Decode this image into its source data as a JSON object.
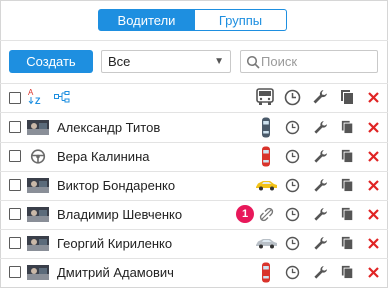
{
  "tabs": [
    {
      "label": "Водители",
      "active": true
    },
    {
      "label": "Группы",
      "active": false
    }
  ],
  "toolbar": {
    "create_label": "Создать",
    "filter_value": "Все",
    "search_placeholder": "Поиск"
  },
  "header_icons": [
    "sort-az-icon",
    "hierarchy-icon",
    "vehicle-bus-icon",
    "schedule-clock-icon",
    "wrench-icon",
    "copy-icon",
    "delete-x-icon"
  ],
  "drivers": [
    {
      "name": "Александр Титов",
      "avatar": "photo-icon",
      "vehicle": "car-dark-top-icon",
      "vehicle_color": "#4a5a6a"
    },
    {
      "name": "Вера Калинина",
      "avatar": "steering-wheel-icon",
      "vehicle": "car-red-top-icon",
      "vehicle_color": "#d9332b"
    },
    {
      "name": "Виктор Бондаренко",
      "avatar": "photo-icon",
      "vehicle": "car-yellow-side-icon",
      "vehicle_color": "#f2c218"
    },
    {
      "name": "Владимир Шевченко",
      "avatar": "photo-icon",
      "vehicle": "unlink-icon",
      "vehicle_color": "#9a9a9a"
    },
    {
      "name": "Георгий Кириленко",
      "avatar": "photo-icon",
      "vehicle": "car-silver-side-icon",
      "vehicle_color": "#b9c0c7"
    },
    {
      "name": "Дмитрий Адамович",
      "avatar": "photo-icon",
      "vehicle": "car-red-top-icon",
      "vehicle_color": "#d9332b"
    }
  ],
  "badge": {
    "label": "1"
  },
  "colors": {
    "accent": "#1e8fe0",
    "delete": "#e02424",
    "badge": "#e8185a"
  }
}
